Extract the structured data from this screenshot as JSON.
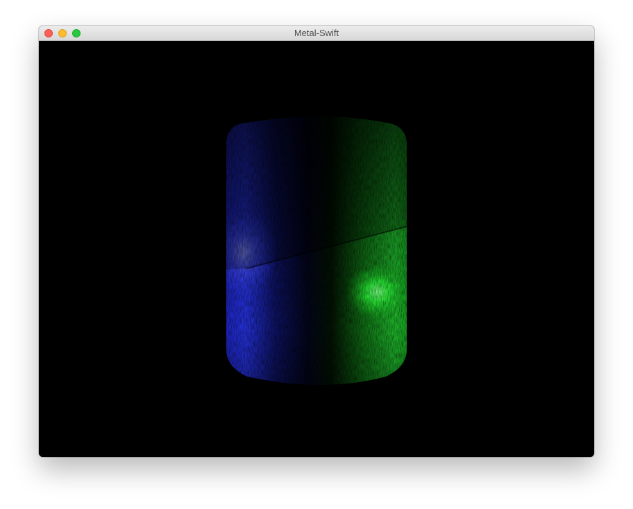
{
  "window": {
    "title": "Metal-Swift",
    "controls": {
      "close_color": "#fe5f57",
      "minimize_color": "#febc2e",
      "zoom_color": "#28c840"
    }
  },
  "scene": {
    "background": "#000000",
    "object": "cylinder",
    "lights": [
      {
        "name": "left-light",
        "color": "#3a46ff"
      },
      {
        "name": "right-light",
        "color": "#2cff3a"
      }
    ]
  }
}
